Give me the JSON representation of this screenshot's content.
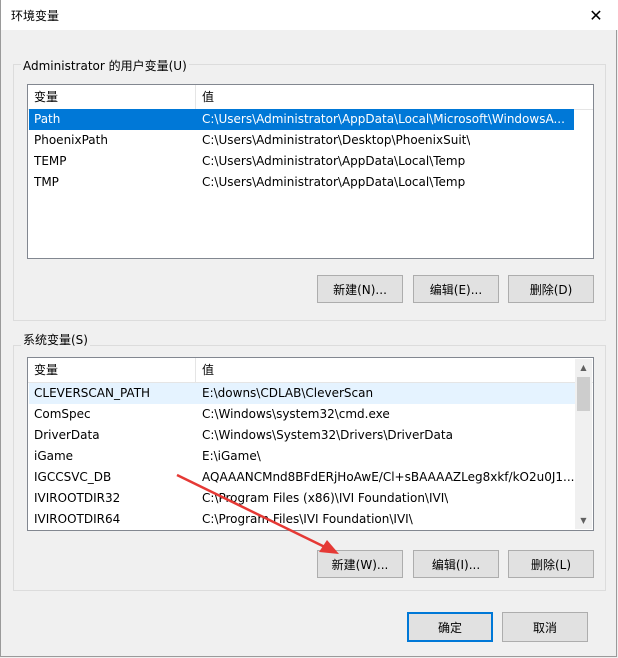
{
  "window": {
    "title": "环境变量",
    "close_glyph": "✕"
  },
  "user_vars": {
    "group_label": "Administrator 的用户变量(U)",
    "col_name": "变量",
    "col_value": "值",
    "rows": [
      {
        "name": "Path",
        "value": "C:\\Users\\Administrator\\AppData\\Local\\Microsoft\\WindowsA...",
        "selected": true
      },
      {
        "name": "PhoenixPath",
        "value": "C:\\Users\\Administrator\\Desktop\\PhoenixSuit\\"
      },
      {
        "name": "TEMP",
        "value": "C:\\Users\\Administrator\\AppData\\Local\\Temp"
      },
      {
        "name": "TMP",
        "value": "C:\\Users\\Administrator\\AppData\\Local\\Temp"
      }
    ],
    "buttons": {
      "new": "新建(N)...",
      "edit": "编辑(E)...",
      "delete": "删除(D)"
    }
  },
  "system_vars": {
    "group_label": "系统变量(S)",
    "col_name": "变量",
    "col_value": "值",
    "rows": [
      {
        "name": "CLEVERSCAN_PATH",
        "value": "E:\\downs\\CDLAB\\CleverScan",
        "highlight": true
      },
      {
        "name": "ComSpec",
        "value": "C:\\Windows\\system32\\cmd.exe"
      },
      {
        "name": "DriverData",
        "value": "C:\\Windows\\System32\\Drivers\\DriverData"
      },
      {
        "name": "iGame",
        "value": "E:\\iGame\\"
      },
      {
        "name": "IGCCSVC_DB",
        "value": "AQAAANCMnd8BFdERjHoAwE/Cl+sBAAAAZLeg8xkf/kO2u0J1..."
      },
      {
        "name": "IVIROOTDIR32",
        "value": "C:\\Program Files (x86)\\IVI Foundation\\IVI\\"
      },
      {
        "name": "IVIROOTDIR64",
        "value": "C:\\Program Files\\IVI Foundation\\IVI\\"
      }
    ],
    "buttons": {
      "new": "新建(W)...",
      "edit": "编辑(I)...",
      "delete": "删除(L)"
    }
  },
  "footer": {
    "ok": "确定",
    "cancel": "取消"
  },
  "colors": {
    "selection": "#0078d7",
    "annotation_arrow": "#e53935"
  }
}
